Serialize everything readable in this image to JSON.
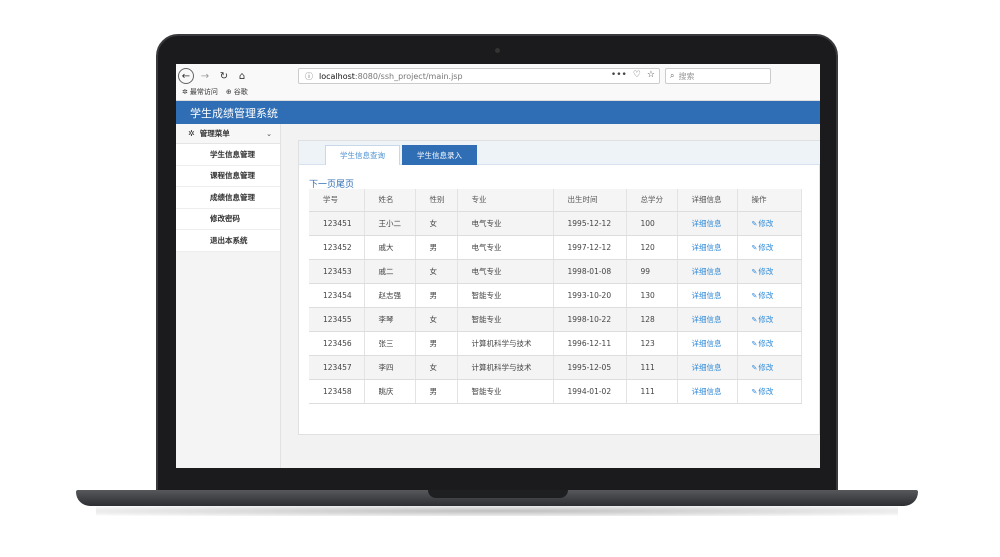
{
  "browser": {
    "url_host": "localhost",
    "url_rest": ":8080/ssh_project/main.jsp",
    "search_placeholder": "搜索",
    "bookmarks": [
      {
        "label": "最常访问"
      },
      {
        "label": "谷歌"
      }
    ]
  },
  "app": {
    "title": "学生成绩管理系统"
  },
  "sidebar": {
    "header": "管理菜单",
    "items": [
      {
        "label": "学生信息管理"
      },
      {
        "label": "课程信息管理"
      },
      {
        "label": "成绩信息管理"
      },
      {
        "label": "修改密码"
      },
      {
        "label": "退出本系统"
      }
    ]
  },
  "main": {
    "tabs": [
      {
        "label": "学生信息查询"
      },
      {
        "label": "学生信息录入"
      }
    ],
    "pager": "下一页尾页",
    "table": {
      "columns": [
        "学号",
        "姓名",
        "性别",
        "专业",
        "出生时间",
        "总学分",
        "详细信息",
        "操作"
      ],
      "rows": [
        {
          "id": "123451",
          "name": "王小二",
          "gender": "女",
          "major": "电气专业",
          "birth": "1995-12-12",
          "credits": "100",
          "detail": "详细信息",
          "action": "修改"
        },
        {
          "id": "123452",
          "name": "戚大",
          "gender": "男",
          "major": "电气专业",
          "birth": "1997-12-12",
          "credits": "120",
          "detail": "详细信息",
          "action": "修改"
        },
        {
          "id": "123453",
          "name": "戚二",
          "gender": "女",
          "major": "电气专业",
          "birth": "1998-01-08",
          "credits": "99",
          "detail": "详细信息",
          "action": "修改"
        },
        {
          "id": "123454",
          "name": "赵志强",
          "gender": "男",
          "major": "智能专业",
          "birth": "1993-10-20",
          "credits": "130",
          "detail": "详细信息",
          "action": "修改"
        },
        {
          "id": "123455",
          "name": "李琴",
          "gender": "女",
          "major": "智能专业",
          "birth": "1998-10-22",
          "credits": "128",
          "detail": "详细信息",
          "action": "修改"
        },
        {
          "id": "123456",
          "name": "张三",
          "gender": "男",
          "major": "计算机科学与技术",
          "birth": "1996-12-11",
          "credits": "123",
          "detail": "详细信息",
          "action": "修改"
        },
        {
          "id": "123457",
          "name": "李四",
          "gender": "女",
          "major": "计算机科学与技术",
          "birth": "1995-12-05",
          "credits": "111",
          "detail": "详细信息",
          "action": "修改"
        },
        {
          "id": "123458",
          "name": "眺庆",
          "gender": "男",
          "major": "智能专业",
          "birth": "1994-01-02",
          "credits": "111",
          "detail": "详细信息",
          "action": "修改"
        }
      ]
    }
  },
  "colors": {
    "header_bg": "#2f6eb5",
    "link": "#2f8ad8"
  }
}
